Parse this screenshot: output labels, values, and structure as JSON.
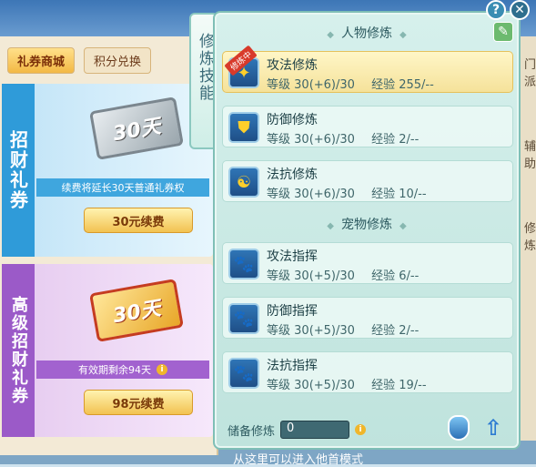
{
  "shop": {
    "tabs": [
      "礼券商城",
      "积分兑换"
    ],
    "cards": [
      {
        "label": "招财礼券",
        "ticket": "30天",
        "note": "续费将延长30天普通礼券权",
        "button": "30元续费"
      },
      {
        "label": "高级招财礼券",
        "ticket": "30天",
        "note": "有效期剩余94天",
        "info": "i",
        "button": "98元续费"
      }
    ]
  },
  "side_tab": {
    "label": "修炼技能"
  },
  "panel": {
    "header_icons": {
      "help": "?",
      "close": "✕"
    },
    "section1_title": "人物修炼",
    "section2_title": "宠物修炼",
    "selected_badge": "修炼中",
    "level_label": "等级",
    "exp_label": "经验",
    "person_skills": [
      {
        "name": "攻法修炼",
        "level": "30(+6)/30",
        "exp": "255/--"
      },
      {
        "name": "防御修炼",
        "level": "30(+6)/30",
        "exp": "2/--"
      },
      {
        "name": "法抗修炼",
        "level": "30(+6)/30",
        "exp": "10/--"
      }
    ],
    "pet_skills": [
      {
        "name": "攻法指挥",
        "level": "30(+5)/30",
        "exp": "6/--"
      },
      {
        "name": "防御指挥",
        "level": "30(+5)/30",
        "exp": "2/--"
      },
      {
        "name": "法抗指挥",
        "level": "30(+5)/30",
        "exp": "19/--"
      }
    ],
    "reserve_label": "储备修炼",
    "reserve_value": "0",
    "info_icon": "i"
  },
  "right_edge": {
    "labels": [
      "门派",
      "辅助",
      "修炼"
    ]
  },
  "footer_text": "从这里可以进入他首模式"
}
